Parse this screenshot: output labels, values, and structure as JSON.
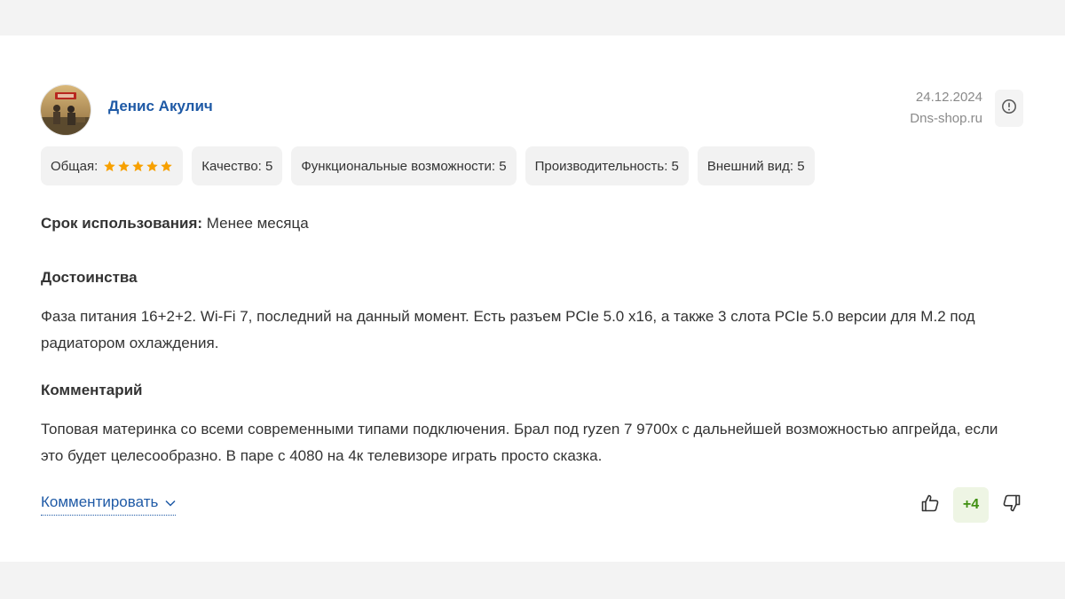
{
  "review": {
    "author": {
      "name": "Денис Акулич"
    },
    "date": "24.12.2024",
    "source": "Dns-shop.ru",
    "ratings": {
      "overall_label": "Общая:",
      "overall_stars": 5,
      "star_color": "#f7a000",
      "items": [
        {
          "label": "Качество: 5"
        },
        {
          "label": "Функциональные возможности: 5"
        },
        {
          "label": "Производительность: 5"
        },
        {
          "label": "Внешний вид: 5"
        }
      ]
    },
    "usage": {
      "label": "Срок использования:",
      "value": "Менее месяца"
    },
    "pros": {
      "title": "Достоинства",
      "text": "Фаза питания 16+2+2. Wi-Fi 7, последний на данный момент. Есть разъем PCIe 5.0 x16, а также 3 слота PCIe 5.0 версии для M.2 под радиатором охлаждения."
    },
    "comment": {
      "title": "Комментарий",
      "text": "Топовая материнка со всеми современными типами подключения. Брал под ryzen 7 9700x с дальнейшей возможностью апгрейда, если это будет целесообразно. В паре с 4080 на 4к телевизоре играть просто сказка."
    },
    "actions": {
      "comment_label": "Комментировать",
      "score": "+4",
      "link_color": "#1f5aa6",
      "score_color": "#3f8f10"
    },
    "icons": {
      "info": "info-circle-icon",
      "chevron": "chevron-down-icon",
      "like": "thumbs-up-icon",
      "dislike": "thumbs-down-icon"
    }
  }
}
